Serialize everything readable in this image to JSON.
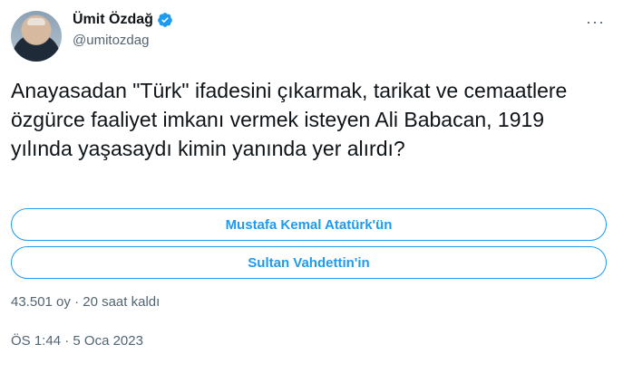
{
  "author": {
    "name": "Ümit Özdağ",
    "handle": "@umitozdag"
  },
  "tweet": {
    "text": "Anayasadan \"Türk\" ifadesini çıkarmak, tarikat ve cemaatlere özgürce faaliyet imkanı vermek isteyen Ali Babacan, 1919 yılında yaşasaydı kimin yanında yer alırdı?"
  },
  "poll": {
    "options": [
      "Mustafa Kemal Atatürk'ün",
      "Sultan Vahdettin'in"
    ],
    "votes": "43.501 oy",
    "separator": "·",
    "time_left": "20 saat kaldı"
  },
  "timestamp": {
    "time": "ÖS 1:44",
    "separator": "·",
    "date": "5 Oca 2023"
  },
  "more_label": "···",
  "colors": {
    "accent": "#1d9bf0",
    "text": "#0f1419",
    "secondary": "#536471"
  }
}
